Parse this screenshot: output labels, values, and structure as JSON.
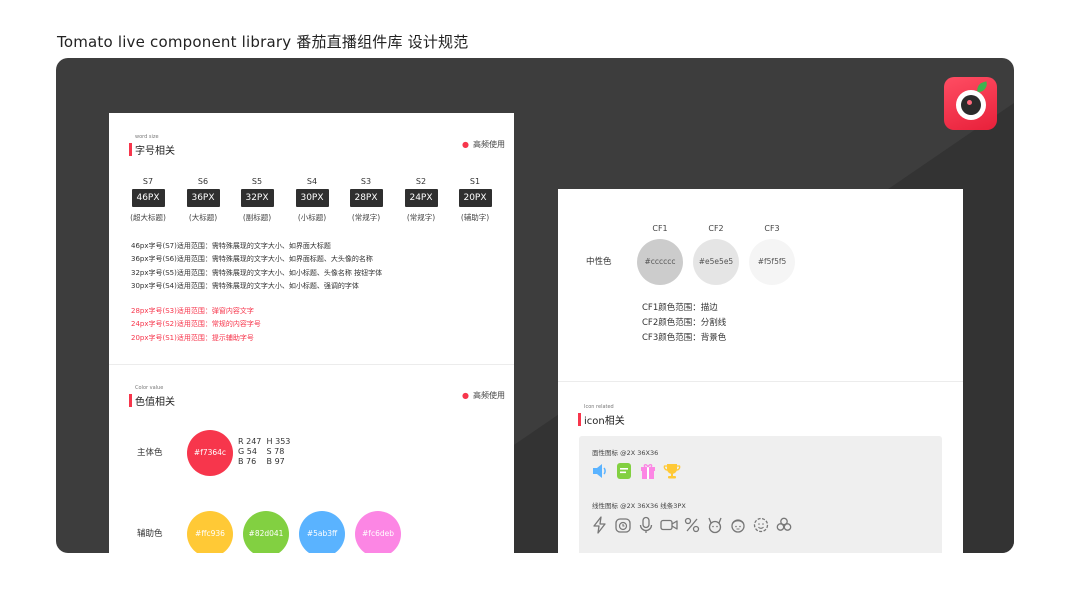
{
  "page": {
    "title": "Tomato live component library  番茄直播组件库  设计规范"
  },
  "font_section": {
    "small_label": "word size",
    "title": "字号相关",
    "frequent": "高频使用",
    "sizes": [
      {
        "label": "S7",
        "value": "46PX",
        "desc": "(超大标题)"
      },
      {
        "label": "S6",
        "value": "36PX",
        "desc": "(大标题)"
      },
      {
        "label": "S5",
        "value": "32PX",
        "desc": "(副标题)"
      },
      {
        "label": "S4",
        "value": "30PX",
        "desc": "(小标题)"
      },
      {
        "label": "S3",
        "value": "28PX",
        "desc": "(常规字)"
      },
      {
        "label": "S2",
        "value": "24PX",
        "desc": "(常规字)"
      },
      {
        "label": "S1",
        "value": "20PX",
        "desc": "(辅助字)"
      }
    ],
    "rules_dark": [
      "46px字号(S7)适用范围：需特殊展现的文字大小、如界面大标题",
      "36px字号(S6)适用范围：需特殊展现的文字大小、如界面标题、大头像的名称",
      "32px字号(S5)适用范围：需特殊展现的文字大小、如小标题、头像名称 按钮字体",
      "30px字号(S4)适用范围：需特殊展现的文字大小、如小标题、强调的字体"
    ],
    "rules_red": [
      "28px字号(S3)适用范围：弹窗内容文字",
      "24px字号(S2)适用范围：常规的内容字号",
      "20px字号(S1)适用范围：提示辅助字号"
    ]
  },
  "color_section": {
    "small_label": "Color value",
    "title": "色值相关",
    "frequent": "高频使用",
    "primary_label": "主体色",
    "primary": {
      "hex": "#f7364c",
      "r": "R 247",
      "g": "G 54",
      "b": "B 76",
      "h": "H 353",
      "s": "S 78",
      "bv": "B 97"
    },
    "aux_label": "辅助色",
    "aux": [
      {
        "hex": "#ffc936",
        "color": "#ffc936"
      },
      {
        "hex": "#82d041",
        "color": "#82d041"
      },
      {
        "hex": "#5ab3ff",
        "color": "#5ab3ff"
      },
      {
        "hex": "#fc6deb",
        "color": "#fc86e4"
      }
    ]
  },
  "neutral_section": {
    "label": "中性色",
    "items": [
      {
        "name": "CF1",
        "hex": "#cccccc",
        "color": "#cccccc"
      },
      {
        "name": "CF2",
        "hex": "#e5e5e5",
        "color": "#e5e5e5"
      },
      {
        "name": "CF3",
        "hex": "#f5f5f5",
        "color": "#f5f5f5"
      }
    ],
    "rules": [
      "CF1颜色范围：描边",
      "CF2颜色范围：分割线",
      "CF3颜色范围：背景色"
    ]
  },
  "icon_section": {
    "small_label": "Icon related",
    "title": "icon相关",
    "filled_label": "面性图标   @2X   36X36",
    "outline_label": "线性图标   @2X   36X36   线条3PX",
    "filled_icons": [
      "speaker-icon",
      "note-icon",
      "gift-icon",
      "trophy-icon"
    ],
    "outline_icons": [
      "lightning-icon",
      "timer-icon",
      "microphone-icon",
      "video-camera-icon",
      "percent-icon",
      "rabbit-face-icon",
      "girl-face-icon",
      "smile-face-icon",
      "clover-icon"
    ]
  },
  "colors": {
    "accent": "#f7364c",
    "board": "#3d3d3d",
    "chip": "#2f2f2f"
  }
}
